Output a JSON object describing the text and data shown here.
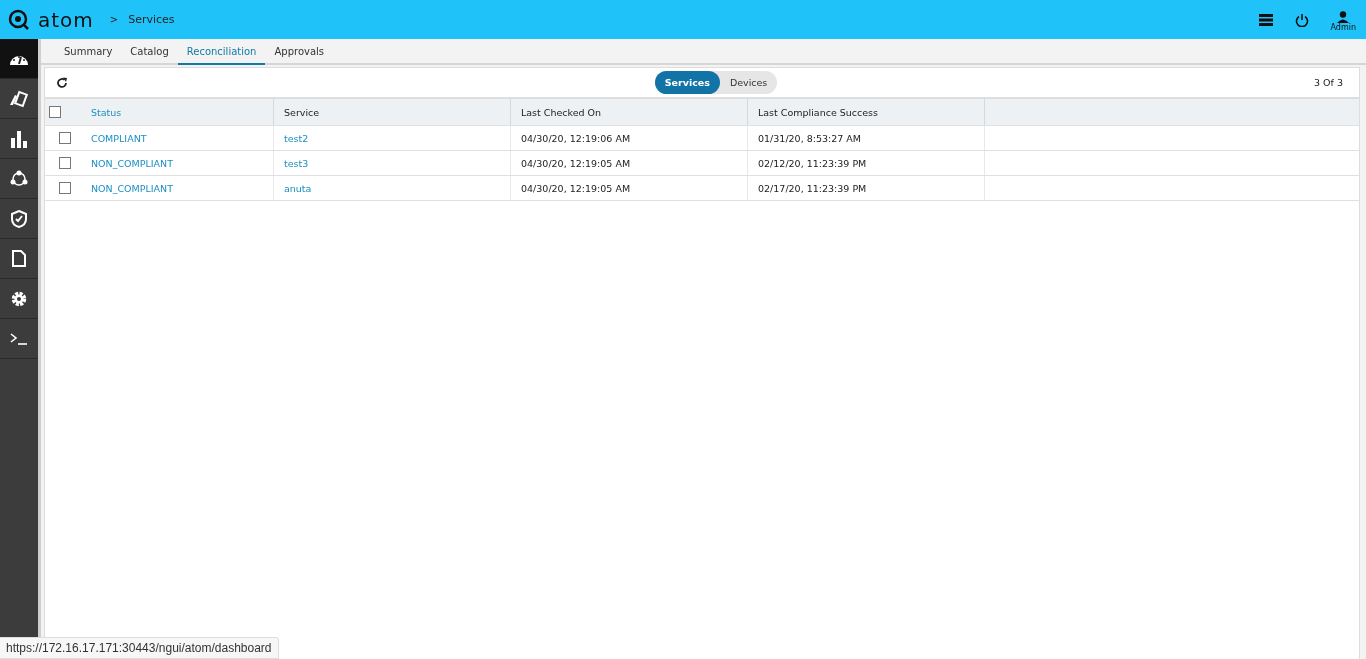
{
  "header": {
    "logo": "atom",
    "breadcrumb_separator": ">",
    "breadcrumb": "Services",
    "user": "Admin"
  },
  "sidebar": {
    "items": [
      {
        "selected": true
      },
      {
        "selected": false
      },
      {
        "selected": false
      },
      {
        "selected": false
      },
      {
        "selected": false
      },
      {
        "selected": false
      },
      {
        "selected": false
      },
      {
        "selected": false
      }
    ]
  },
  "tabs": [
    {
      "label": "Summary",
      "selected": false
    },
    {
      "label": "Catalog",
      "selected": false
    },
    {
      "label": "Reconciliation",
      "selected": true
    },
    {
      "label": "Approvals",
      "selected": false
    }
  ],
  "toggle": [
    {
      "label": "Services",
      "selected": true
    },
    {
      "label": "Devices",
      "selected": false
    }
  ],
  "counter": "3 Of 3",
  "table": {
    "select_all_checked": false,
    "columns": [
      "Status",
      "Service",
      "Last Checked On",
      "Last Compliance Success"
    ],
    "rows": [
      {
        "checked": false,
        "status": "COMPLIANT",
        "service": "test2",
        "last_checked_on": "04/30/20, 12:19:06 AM",
        "last_compliance_success": "01/31/20, 8:53:27 AM"
      },
      {
        "checked": false,
        "status": "NON_COMPLIANT",
        "service": "test3",
        "last_checked_on": "04/30/20, 12:19:05 AM",
        "last_compliance_success": "02/12/20, 11:23:39 PM"
      },
      {
        "checked": false,
        "status": "NON_COMPLIANT",
        "service": "anuta",
        "last_checked_on": "04/30/20, 12:19:05 AM",
        "last_compliance_success": "02/17/20, 11:23:39 PM"
      }
    ]
  },
  "status_link": "https://172.16.17.171:30443/ngui/atom/dashboard"
}
